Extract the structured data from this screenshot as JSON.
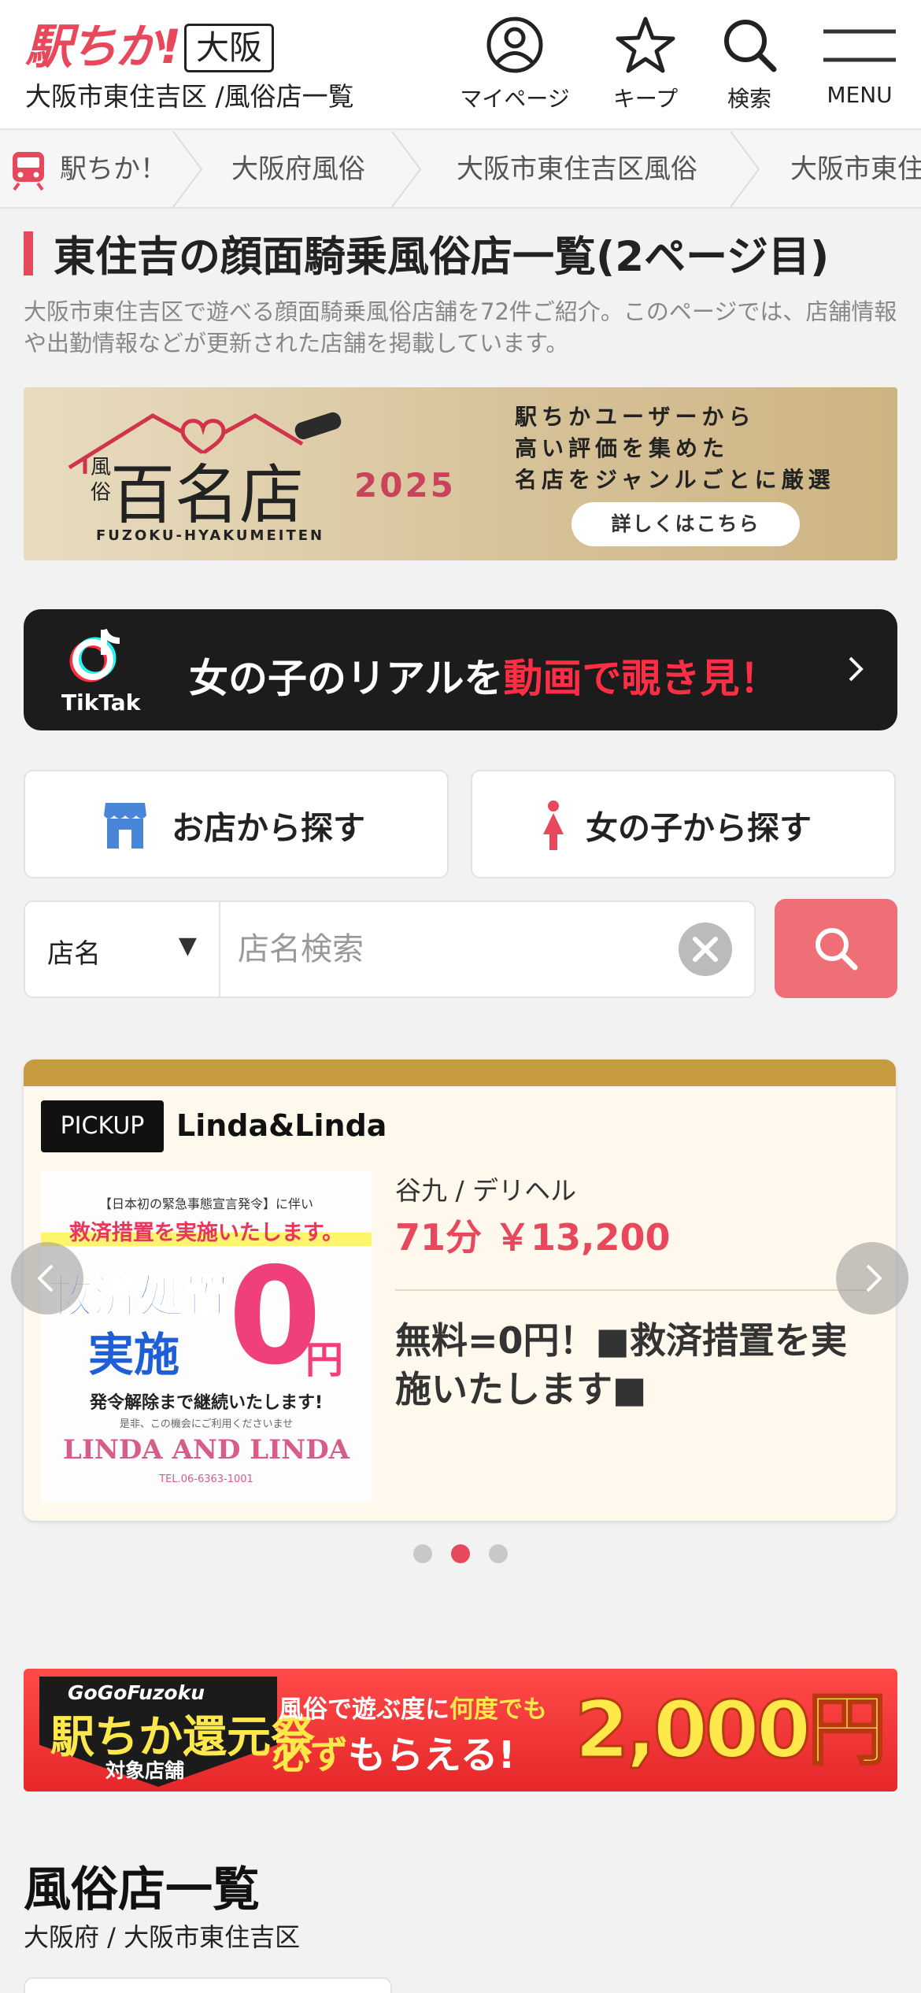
{
  "header": {
    "logo": "駅ちか!",
    "area": "大阪",
    "subtitle": "大阪市東住吉区 /風俗店一覧",
    "nav": {
      "mypage": "マイページ",
      "keep": "キープ",
      "search": "検索",
      "menu": "MENU"
    }
  },
  "breadcrumb": [
    "駅ちか！",
    "大阪府風俗",
    "大阪市東住吉区風俗",
    "大阪市東住"
  ],
  "page": {
    "title": "東住吉の顔面騎乗風俗店一覧(2ページ目)",
    "description": "大阪市東住吉区で遊べる顔面騎乗風俗店舗を72件ご紹介。このページでは、店舗情報や出勤情報などが更新された店舗を掲載しています。"
  },
  "hyakumeiten_banner": {
    "kana": "風俗",
    "title": "百名店",
    "year": "2025",
    "roman": "FUZOKU-HYAKUMEITEN",
    "copy_line1": "駅ちかユーザーから",
    "copy_line2": "高い評価を集めた",
    "copy_line3": "名店をジャンルごとに厳選",
    "button": "詳しくはこちら"
  },
  "tiktak_banner": {
    "brand": "TikTak",
    "text_main": "女の子のリアルを",
    "text_highlight": "動画で覗き見！"
  },
  "search_tabs": {
    "shop": "お店から探す",
    "girl": "女の子から探す"
  },
  "search_bar": {
    "select_value": "店名",
    "placeholder": "店名検索",
    "value": ""
  },
  "pickup": {
    "badge": "PICKUP",
    "shop_name": "Linda&Linda",
    "area_genre": "谷九 / デリヘル",
    "price": "71分 ￥13,200",
    "catch": "無料=0円！■救済措置を実施いたします■",
    "image_text": {
      "line1": "【日本初の緊急事態宣言発令】に伴い",
      "line2": "救済措置を実施いたします。",
      "big1": "救済処置",
      "big2": "実施",
      "zero": "0",
      "yen": "円",
      "line3": "発令解除まで継続いたします!",
      "line4": "是非、この機会にご利用くださいませ",
      "logo": "LINDA AND LINDA",
      "tel": "TEL.06-6363-1001"
    },
    "dots_total": 3,
    "dots_active": 2
  },
  "campaign_banner": {
    "gogo": "GoGoFuzoku",
    "main": "駅ちか還元祭",
    "target": "対象店舗",
    "line1_a": "風俗で遊ぶ度に",
    "line1_b": "何度でも",
    "line2_a": "必ず",
    "line2_b": "もらえる!",
    "amount": "2,000円"
  },
  "list": {
    "title": "風俗店一覧",
    "subtitle": "大阪府 / 大阪市東住吉区"
  },
  "colors": {
    "brand_red": "#e8485b",
    "search_button": "#ef6f77",
    "pickup_gold": "#c79b40",
    "tiktak_bg": "#1c1c1c"
  }
}
